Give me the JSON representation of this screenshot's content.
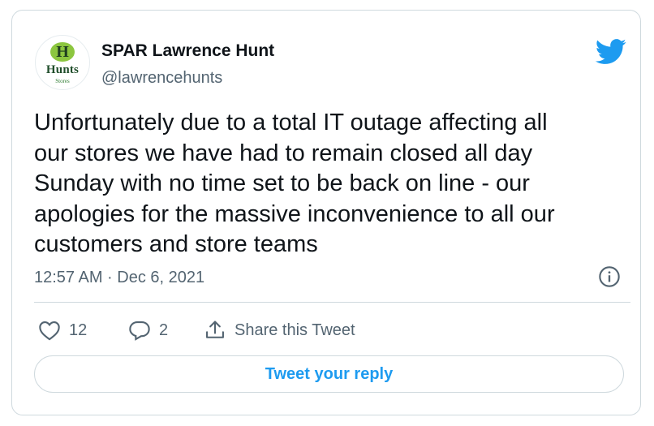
{
  "author": {
    "display_name": "SPAR Lawrence Hunt",
    "handle": "@lawrencehunts",
    "avatar_logo": {
      "letter": "H",
      "word": "Hunts",
      "sub": "Stores"
    }
  },
  "tweet": {
    "lines": [
      "Unfortunately due to a total IT outage affecting all",
      "our stores we have had to remain closed all day",
      "Sunday with no time set to be back on line - our",
      "apologies for the massive inconvenience to all our",
      "customers and store teams"
    ],
    "timestamp": "12:57 AM · Dec 6, 2021"
  },
  "actions": {
    "likes": "12",
    "replies": "2",
    "share_label": "Share this Tweet"
  },
  "reply_button": {
    "label": "Tweet your reply"
  },
  "icons": {
    "brand": "twitter-bird-icon",
    "info": "info-icon",
    "like": "heart-icon",
    "reply": "speech-bubble-icon",
    "share": "share-upload-icon"
  },
  "colors": {
    "accent": "#1d9bf0",
    "secondary_text": "#536471",
    "border": "#cfd9de",
    "logo_green": "#8cc63f"
  }
}
